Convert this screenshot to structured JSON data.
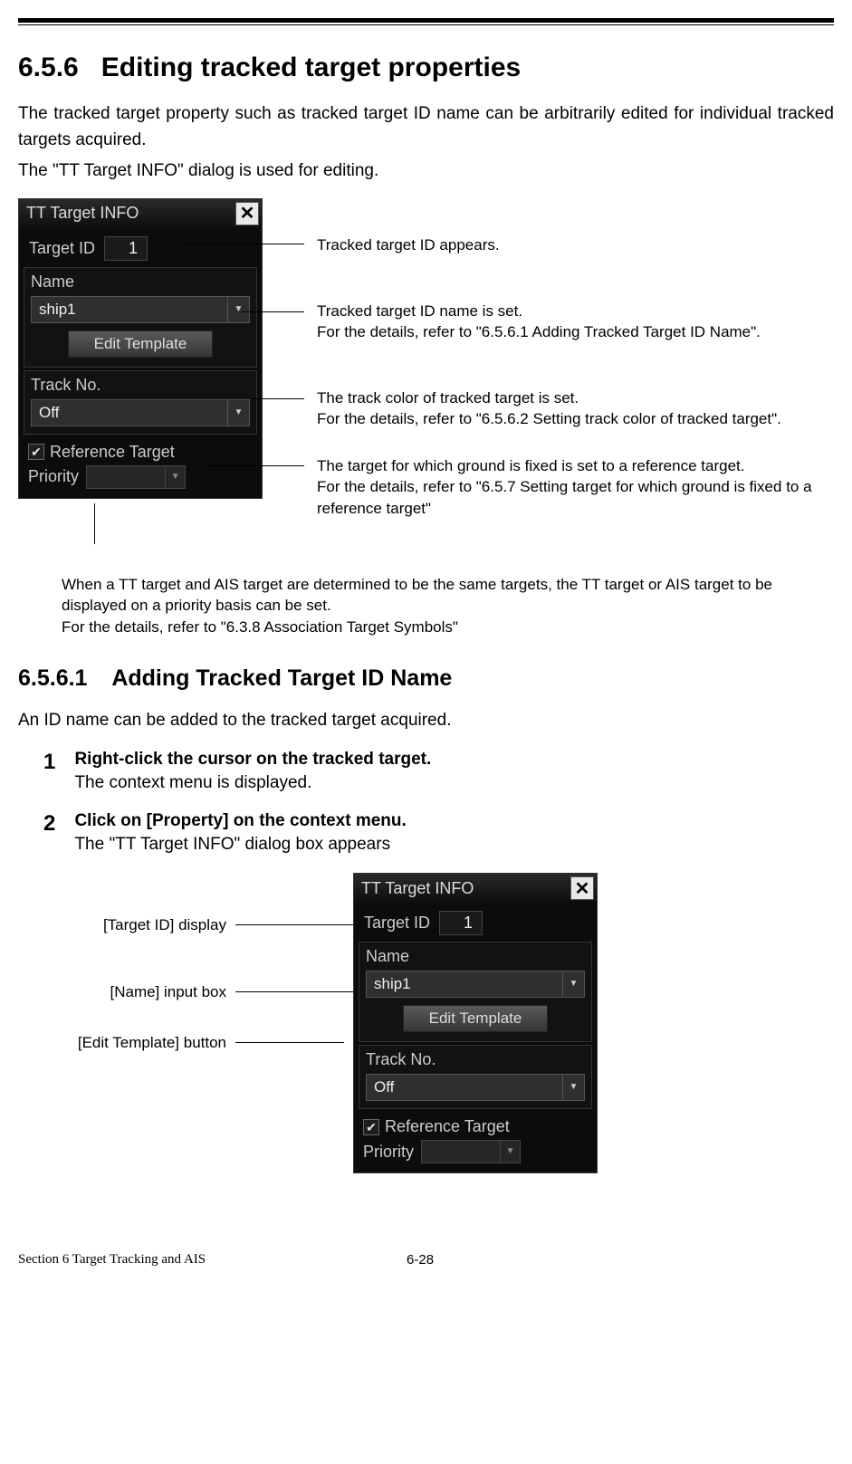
{
  "section": {
    "number": "6.5.6",
    "title": "Editing tracked target properties",
    "intro_p1": "The tracked target property such as tracked target ID name can be arbitrarily edited for individual tracked targets acquired.",
    "intro_p2": "The \"TT Target INFO\" dialog is used for editing."
  },
  "dialog": {
    "title": "TT Target INFO",
    "close_label": "✕",
    "target_id_label": "Target ID",
    "target_id_value": "1",
    "name_label": "Name",
    "name_value": "ship1",
    "edit_template_label": "Edit Template",
    "track_no_label": "Track No.",
    "track_no_value": "Off",
    "reference_target_label": "Reference Target",
    "reference_target_checked": true,
    "priority_label": "Priority",
    "priority_value": ""
  },
  "callouts": {
    "target_id": "Tracked target ID appears.",
    "name_line1": "Tracked target ID name is set.",
    "name_line2": "For the details, refer to \"6.5.6.1 Adding Tracked Target ID Name\".",
    "track_line1": "The track color of tracked target is set.",
    "track_line2": "For the details, refer to \"6.5.6.2 Setting track color of tracked target\".",
    "ref_line1": "The target for which ground is fixed is set to a reference target.",
    "ref_line2": "For the details, refer to \"6.5.7 Setting target for which ground is fixed to a reference target\"",
    "priority_line1": "When a TT target and AIS target are determined to be the same targets, the TT target or AIS target to be displayed on a priority basis can be set.",
    "priority_line2": "For the details, refer to \"6.3.8 Association Target Symbols\""
  },
  "subsection": {
    "number": "6.5.6.1",
    "title": "Adding Tracked Target ID Name",
    "intro": "An ID name can be added to the tracked target acquired."
  },
  "steps": {
    "s1_title": "Right-click the cursor on the tracked target.",
    "s1_desc": "The context menu is displayed.",
    "s2_title": "Click on [Property] on the context menu.",
    "s2_desc": "The \"TT Target INFO\" dialog box appears"
  },
  "fig2_labels": {
    "target_id": "[Target ID] display",
    "name": "[Name] input box",
    "edit_template": "[Edit Template] button"
  },
  "footer": {
    "left": "Section 6   Target Tracking and AIS",
    "center": "6-28"
  }
}
